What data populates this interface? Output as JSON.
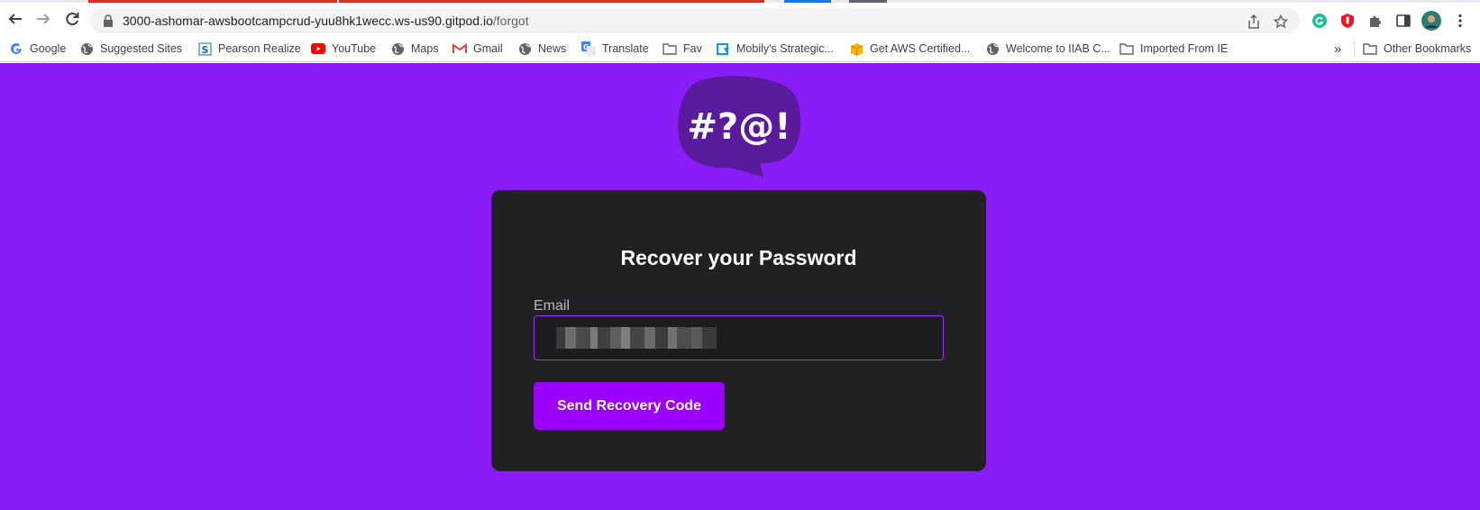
{
  "browser": {
    "url_host": "3000-ashomar-awsbootcampcrud-yuu8hk1wecc.ws-us90.gitpod.io",
    "url_path": "/forgot",
    "bookmarks": [
      {
        "label": "Google",
        "icon": "google-icon"
      },
      {
        "label": "Suggested Sites",
        "icon": "globe-icon"
      },
      {
        "label": "Pearson Realize",
        "icon": "pearson-icon"
      },
      {
        "label": "YouTube",
        "icon": "youtube-icon"
      },
      {
        "label": "Maps",
        "icon": "globe-icon"
      },
      {
        "label": "Gmail",
        "icon": "gmail-icon"
      },
      {
        "label": "News",
        "icon": "globe-icon"
      },
      {
        "label": "Translate",
        "icon": "translate-icon"
      },
      {
        "label": "Fav",
        "icon": "folder-icon"
      },
      {
        "label": "Mobily's Strategic...",
        "icon": "mobily-icon"
      },
      {
        "label": "Get AWS Certified...",
        "icon": "box-icon"
      },
      {
        "label": "Welcome to IIAB C...",
        "icon": "globe-icon"
      },
      {
        "label": "Imported From IE",
        "icon": "folder-icon"
      }
    ],
    "overflow_label": "»",
    "other_bookmarks": "Other Bookmarks"
  },
  "page": {
    "logo_text": "#?@!",
    "title": "Recover your Password",
    "email_label": "Email",
    "email_value_obscured": true,
    "send_button": "Send Recovery Code",
    "colors": {
      "background": "#8a1cf7",
      "card": "#212123",
      "button": "#9b00ff",
      "input_border": "#9b30ff",
      "logo_bubble": "#5a1a9c"
    }
  }
}
